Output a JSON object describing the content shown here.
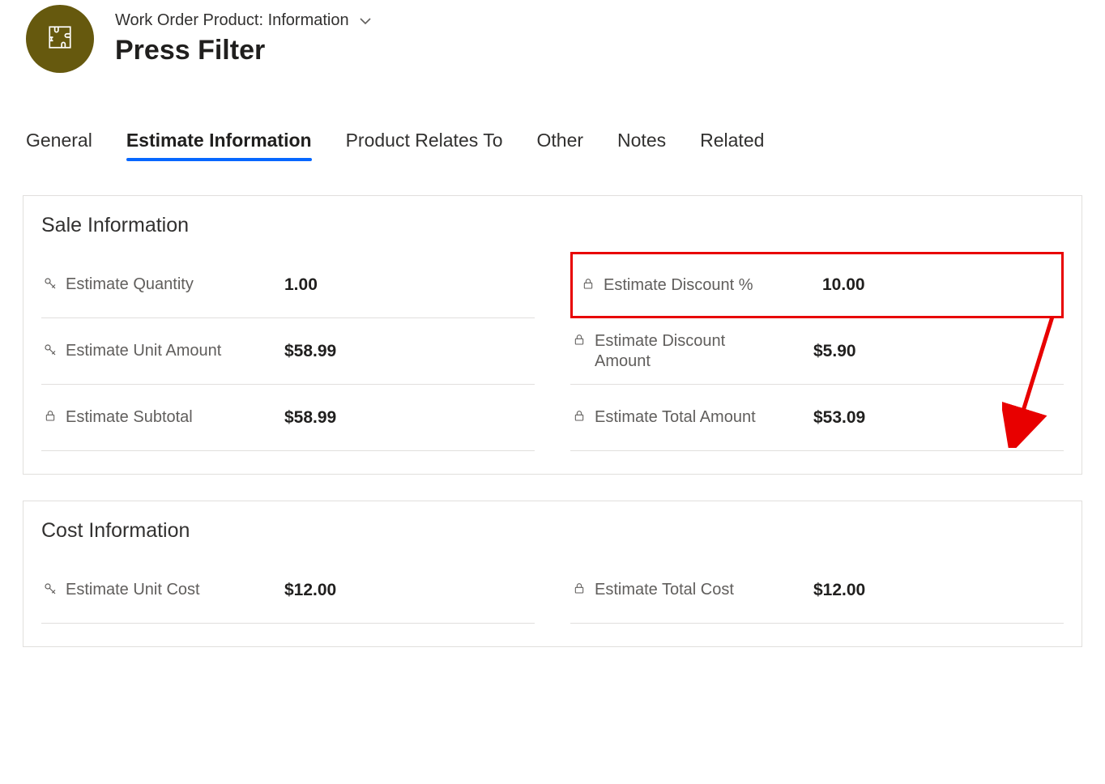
{
  "header": {
    "breadcrumb": "Work Order Product: Information",
    "title": "Press Filter"
  },
  "tabs": {
    "general": "General",
    "estimate": "Estimate Information",
    "relates": "Product Relates To",
    "other": "Other",
    "notes": "Notes",
    "related": "Related"
  },
  "sale": {
    "section_title": "Sale Information",
    "left": {
      "qty_label": "Estimate Quantity",
      "qty_value": "1.00",
      "unit_amt_label": "Estimate Unit Amount",
      "unit_amt_value": "$58.99",
      "subtotal_label": "Estimate Subtotal",
      "subtotal_value": "$58.99"
    },
    "right": {
      "disc_pct_label": "Estimate Discount %",
      "disc_pct_value": "10.00",
      "disc_amt_label": "Estimate Discount Amount",
      "disc_amt_value": "$5.90",
      "total_amt_label": "Estimate Total Amount",
      "total_amt_value": "$53.09"
    }
  },
  "cost": {
    "section_title": "Cost Information",
    "left": {
      "unit_cost_label": "Estimate Unit Cost",
      "unit_cost_value": "$12.00"
    },
    "right": {
      "total_cost_label": "Estimate Total Cost",
      "total_cost_value": "$12.00"
    }
  },
  "annotations": {
    "highlighted_field": "estimate-discount-percent",
    "arrow_from": "estimate-discount-percent",
    "arrow_to": "estimate-total-amount"
  }
}
